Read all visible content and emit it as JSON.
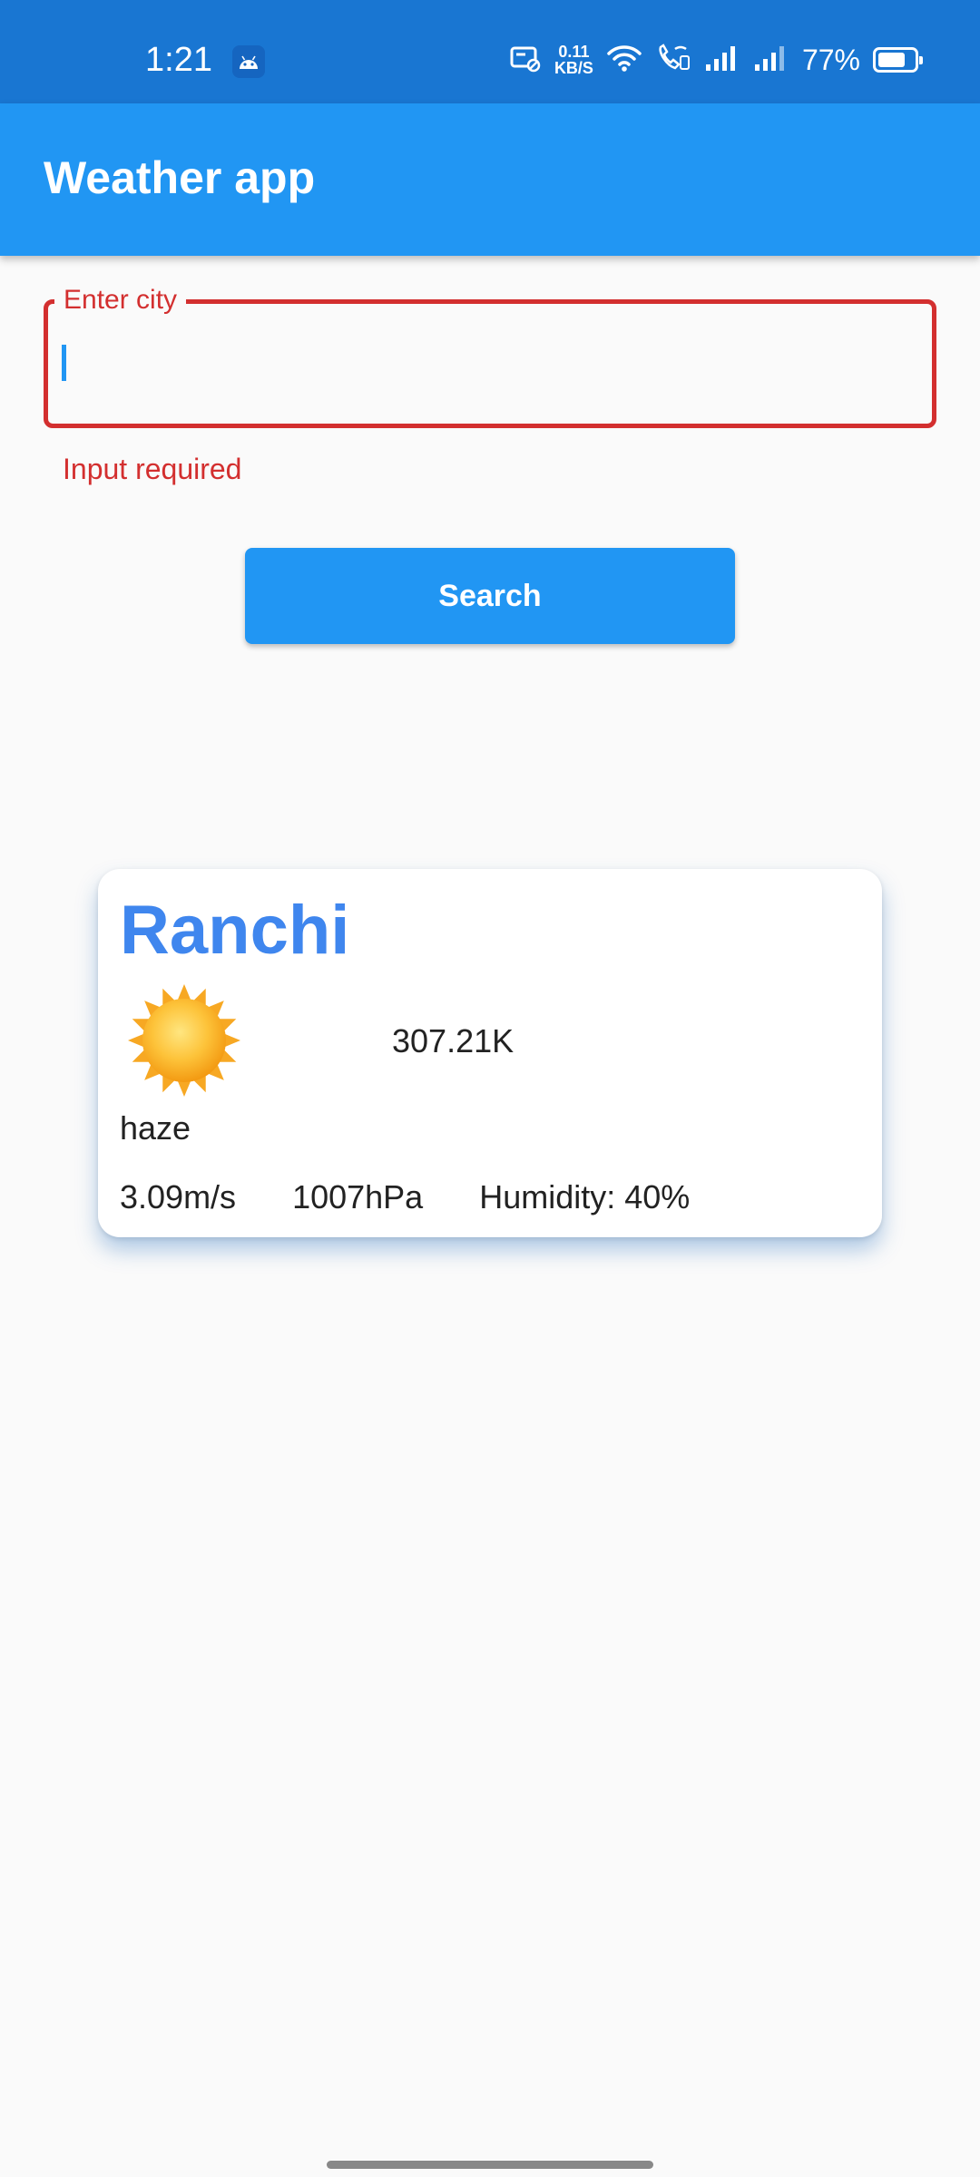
{
  "status_bar": {
    "time": "1:21",
    "speed_value": "0.11",
    "speed_unit": "KB/S",
    "battery": "77%",
    "battery_level": 0.77,
    "icons": [
      "android-icon",
      "no-sim-notification-icon",
      "wifi-icon",
      "wifi-call-icon",
      "signal-icon",
      "signal-icon",
      "battery-icon"
    ]
  },
  "app_bar": {
    "title": "Weather app"
  },
  "search": {
    "label": "Enter city",
    "value": "",
    "error": "Input required",
    "button_label": "Search"
  },
  "weather": {
    "city": "Ranchi",
    "icon": "sun-icon",
    "temperature": "307.21K",
    "condition": "haze",
    "wind": "3.09m/s",
    "pressure": "1007hPa",
    "humidity": "Humidity: 40%"
  },
  "colors": {
    "status_bar": "#1976d2",
    "app_bar": "#2196f3",
    "error": "#d32f2f",
    "city_name": "#3f86ee"
  }
}
